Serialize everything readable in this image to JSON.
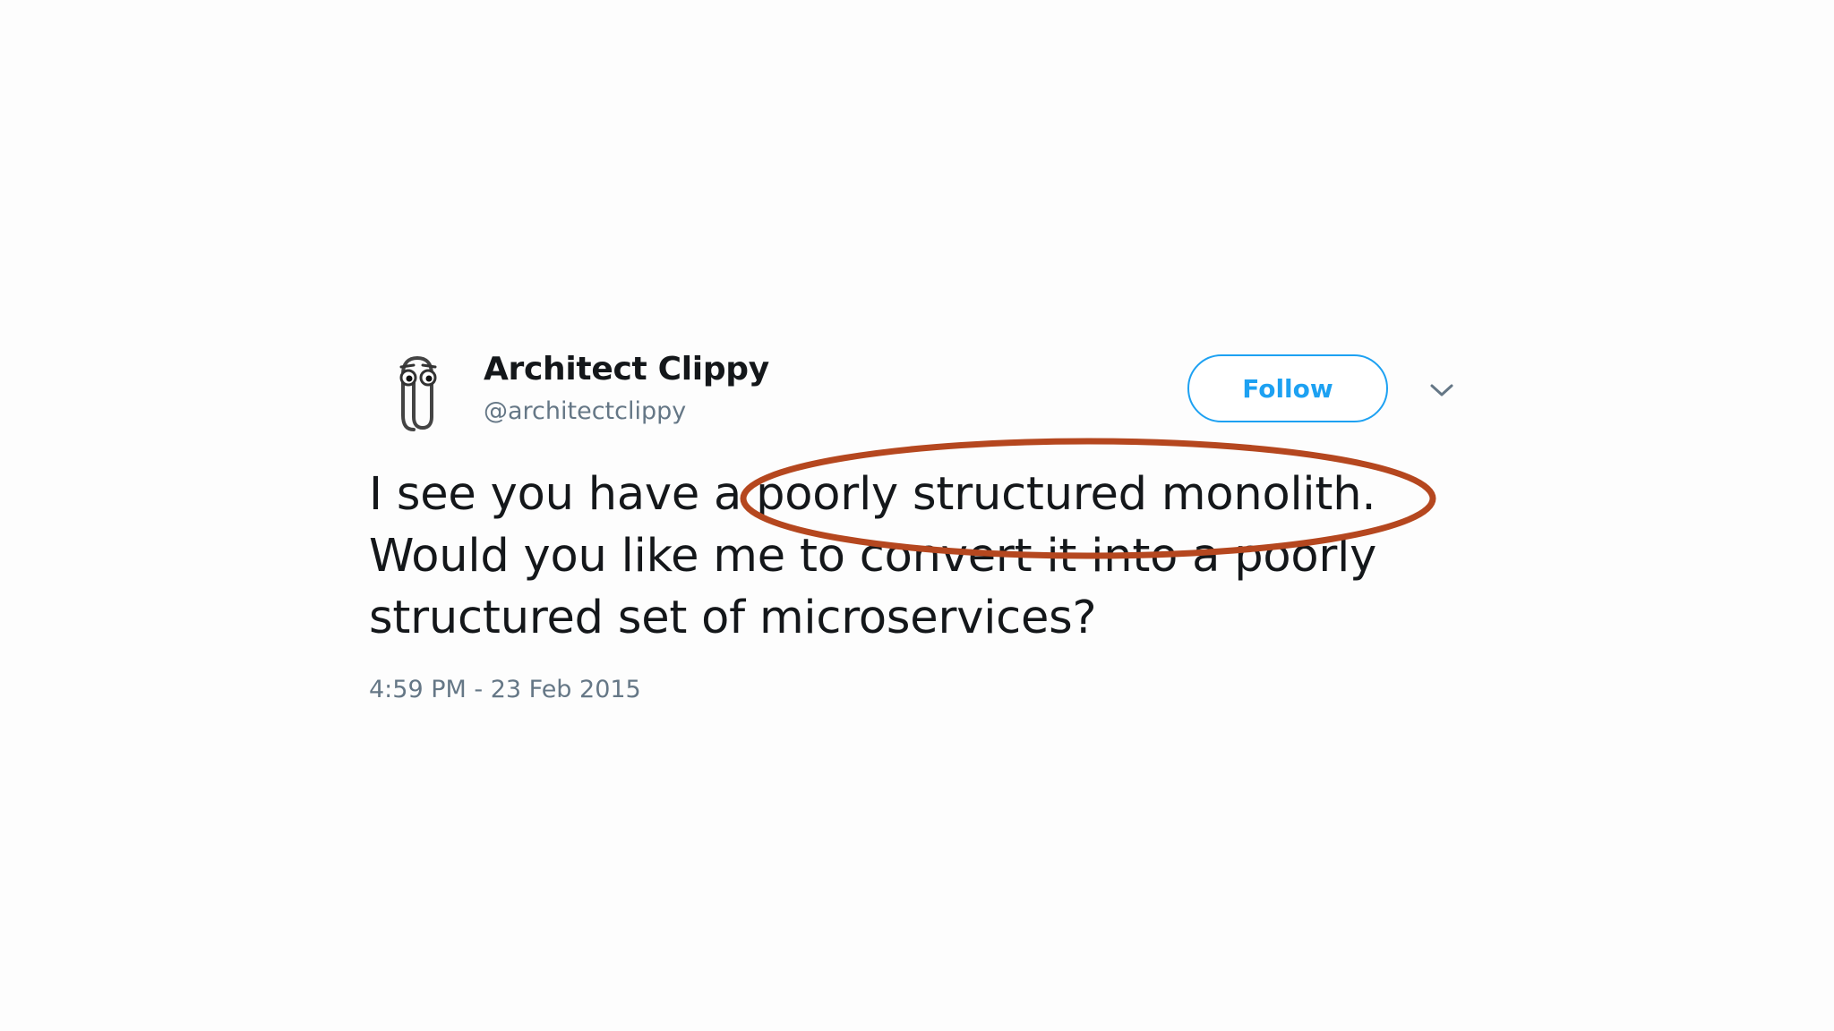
{
  "tweet": {
    "author_name": "Architect Clippy",
    "author_handle": "@architectclippy",
    "follow_label": "Follow",
    "text_lines": [
      "I see you have a poorly structured monolith.",
      "Would you like me to convert it into a poorly",
      "structured set of microservices?"
    ],
    "timestamp": "4:59 PM - 23 Feb 2015"
  },
  "colors": {
    "accent": "#1da1f2",
    "text": "#14171a",
    "muted": "#657786",
    "annotation": "#b5471f"
  },
  "icons": {
    "avatar": "paperclip-icon",
    "menu": "chevron-down-icon"
  }
}
